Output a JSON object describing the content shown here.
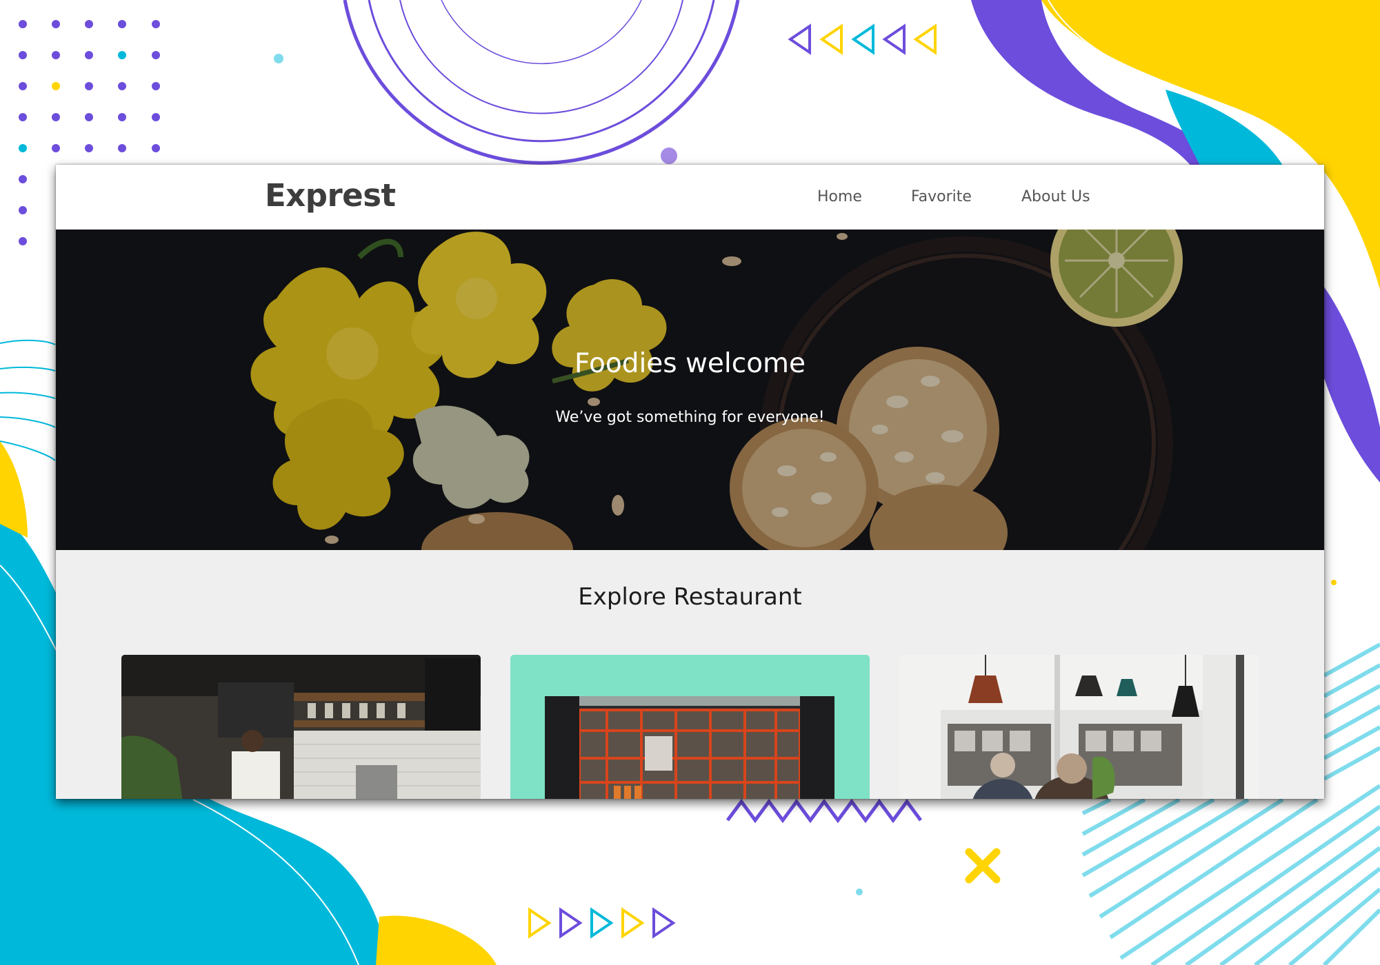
{
  "app": {
    "brand": "Exprest"
  },
  "nav": {
    "items": [
      {
        "label": "Home"
      },
      {
        "label": "Favorite"
      },
      {
        "label": "About Us"
      }
    ]
  },
  "hero": {
    "title": "Foodies welcome",
    "subtitle": "We’ve got something for everyone!"
  },
  "explore": {
    "title": "Explore Restaurant",
    "cards": [
      {
        "image": "coffee-bar-photo"
      },
      {
        "image": "mint-storefront-photo"
      },
      {
        "image": "cafe-interior-photo"
      }
    ]
  },
  "colors": {
    "purple": "#6c4ddc",
    "yellow": "#ffd400",
    "cyan": "#00b9da",
    "hero_bg": "#16171b",
    "section_bg": "#efefef"
  }
}
